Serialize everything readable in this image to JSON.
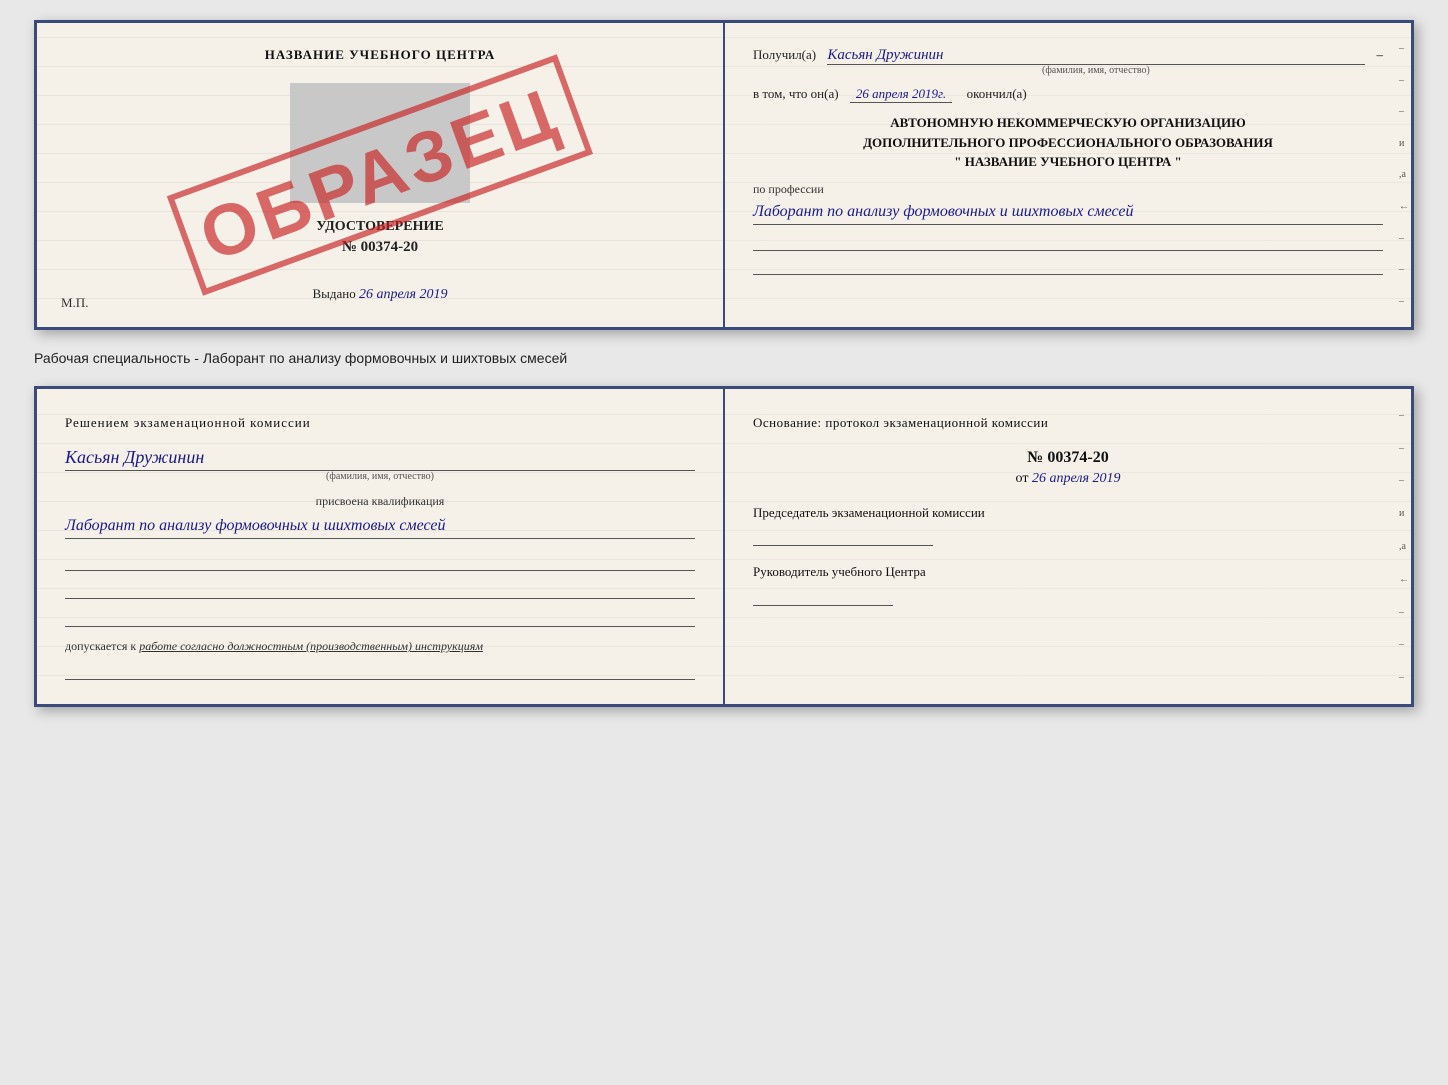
{
  "cert": {
    "left": {
      "title": "НАЗВАНИЕ УЧЕБНОГО ЦЕНТРА",
      "doc_type": "УДОСТОВЕРЕНИЕ",
      "doc_number": "№ 00374-20",
      "vydano_label": "Выдано",
      "vydano_date": "26 апреля 2019",
      "mp_label": "М.П.",
      "stamp_text": "ОБРАЗЕЦ"
    },
    "right": {
      "poluchil_label": "Получил(а)",
      "recipient_name": "Касьян Дружинин",
      "name_sub": "(фамилия, имя, отчество)",
      "vtom_label": "в том, что он(а)",
      "date_value": "26 апреля 2019г.",
      "okonchil_label": "окончил(а)",
      "org_line1": "АВТОНОМНУЮ НЕКОММЕРЧЕСКУЮ ОРГАНИЗАЦИЮ",
      "org_line2": "ДОПОЛНИТЕЛЬНОГО ПРОФЕССИОНАЛЬНОГО ОБРАЗОВАНИЯ",
      "org_line3": "\"  НАЗВАНИЕ УЧЕБНОГО ЦЕНТРА  \"",
      "profession_label": "по профессии",
      "profession_value": "Лаборант по анализу формовочных и шихтовых смесей"
    }
  },
  "specialty_text": "Рабочая специальность - Лаборант по анализу формовочных и шихтовых смесей",
  "qual": {
    "left": {
      "heading": "Решением экзаменационной комиссии",
      "name_value": "Касьян Дружинин",
      "name_sub": "(фамилия, имя, отчество)",
      "assigned_label": "присвоена квалификация",
      "profession_value": "Лаборант по анализу формовочных и шихтовых смесей",
      "dopuskaetsya_label": "допускается к",
      "dopuskaetsya_value": "работе согласно должностным (производственным) инструкциям"
    },
    "right": {
      "heading": "Основание: протокол экзаменационной комиссии",
      "protocol_number": "№ 00374-20",
      "date_prefix": "от",
      "date_value": "26 апреля 2019",
      "chairman_label": "Председатель экзаменационной комиссии",
      "rukovoditel_label": "Руководитель учебного Центра"
    }
  },
  "right_edge_marks": {
    "marks": [
      "–",
      "–",
      "–",
      "и",
      "а",
      "←",
      "–",
      "–",
      "–"
    ]
  }
}
